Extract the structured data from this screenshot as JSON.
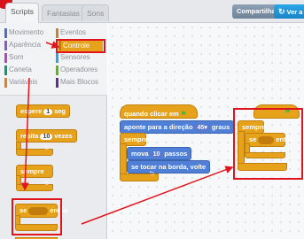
{
  "tabs": [
    "Scripts",
    "Fantasias",
    "Sons"
  ],
  "toolbar": {
    "share": "Compartilhar",
    "see_project": "Ver a"
  },
  "categories": [
    {
      "label": "Movimento",
      "color": "#4a6cd4"
    },
    {
      "label": "Eventos",
      "color": "#c88330"
    },
    {
      "label": "Aparência",
      "color": "#8a55d7"
    },
    {
      "label": "Controle",
      "color": "#e1a91a",
      "selected": true
    },
    {
      "label": "Som",
      "color": "#bb42c3"
    },
    {
      "label": "Sensores",
      "color": "#2ca5e2"
    },
    {
      "label": "Caneta",
      "color": "#0e9a6c"
    },
    {
      "label": "Operadores",
      "color": "#5cb712"
    },
    {
      "label": "Variáveis",
      "color": "#ee7d16"
    },
    {
      "label": "Mais Blocos",
      "color": "#632d99"
    }
  ],
  "palette_blocks": {
    "wait": {
      "text": "espere",
      "value": "1",
      "unit": "seg"
    },
    "repeat": {
      "text": "repita",
      "value": "10",
      "unit": "vezes"
    },
    "forever": "sempre",
    "if_then": {
      "if": "se",
      "then": "então"
    }
  },
  "script": {
    "hat": "quando clicar em",
    "point": {
      "text": "aponte para a direção",
      "value": "45▾",
      "unit": "graus"
    },
    "forever": "sempre",
    "move": {
      "text": "mova",
      "value": "10",
      "unit": "passos"
    },
    "bounce": "se tocar na borda, volte"
  },
  "script2": {
    "forever": "sempre",
    "if_then": {
      "if": "se",
      "then": "então"
    }
  },
  "colors": {
    "control": "#e6a21b",
    "motion": "#4f7fd6",
    "highlight": "#e0141c"
  }
}
